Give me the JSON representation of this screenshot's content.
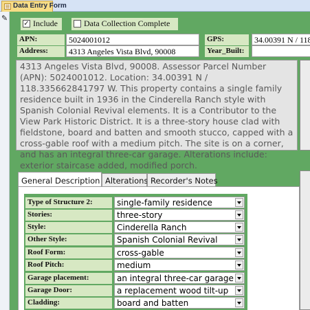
{
  "window": {
    "form_tab_title": "Data Entry Form",
    "pencil_symbol": "✎"
  },
  "checks": {
    "include_label": "Include",
    "include_checked": true,
    "include_mark": "✓",
    "complete_label": "Data Collection Complete",
    "complete_checked": false
  },
  "fields": {
    "apn_label": "APN:",
    "apn_value": "5024001012",
    "address_label": "Address:",
    "address_value": "4313 Angeles Vista Blvd, 90008",
    "gps_label": "GPS:",
    "gps_value": "34.00391 N / 118",
    "year_built_label": "Year_Built:",
    "year_built_value": ""
  },
  "description": "4313 Angeles Vista Blvd, 90008. Assessor Parcel Number (APN): 5024001012. Location: 34.00391 N / 118.335662841797 W. This property contains a single family residence built in 1936 in the Cinderella Ranch style with Spanish Colonial Revival elements. It is a Contributor to the View Park Historic District.  It is a three-story house clad with fieldstone, board and batten and smooth stucco, capped  with a cross-gable roof with a medium pitch. The site is on a corner, and has an integral three-car garage. Alterations include: exterior staircase added, modified porch.",
  "tabs": [
    "General Description",
    "Alterations",
    "Recorder's Notes"
  ],
  "general": {
    "rows": [
      {
        "label": "Type of Structure 2:",
        "value": "single-family residence"
      },
      {
        "label": "Stories:",
        "value": "three-story"
      },
      {
        "label": "Style:",
        "value": "Cinderella Ranch"
      },
      {
        "label": "Other Style:",
        "value": "Spanish Colonial Revival"
      },
      {
        "label": "Roof Form:",
        "value": "cross-gable"
      },
      {
        "label": "Roof Pitch:",
        "value": "medium"
      },
      {
        "label": "Garage placement:",
        "value": "an integral three-car garage"
      },
      {
        "label": "Garage Door:",
        "value": "a replacement wood tilt-up"
      },
      {
        "label": "Cladding:",
        "value": "board and batten"
      }
    ]
  },
  "colors": {
    "form_background": "#61a862",
    "label_background": "#d7e8c3",
    "tab_highlight": "#f7dc85"
  }
}
